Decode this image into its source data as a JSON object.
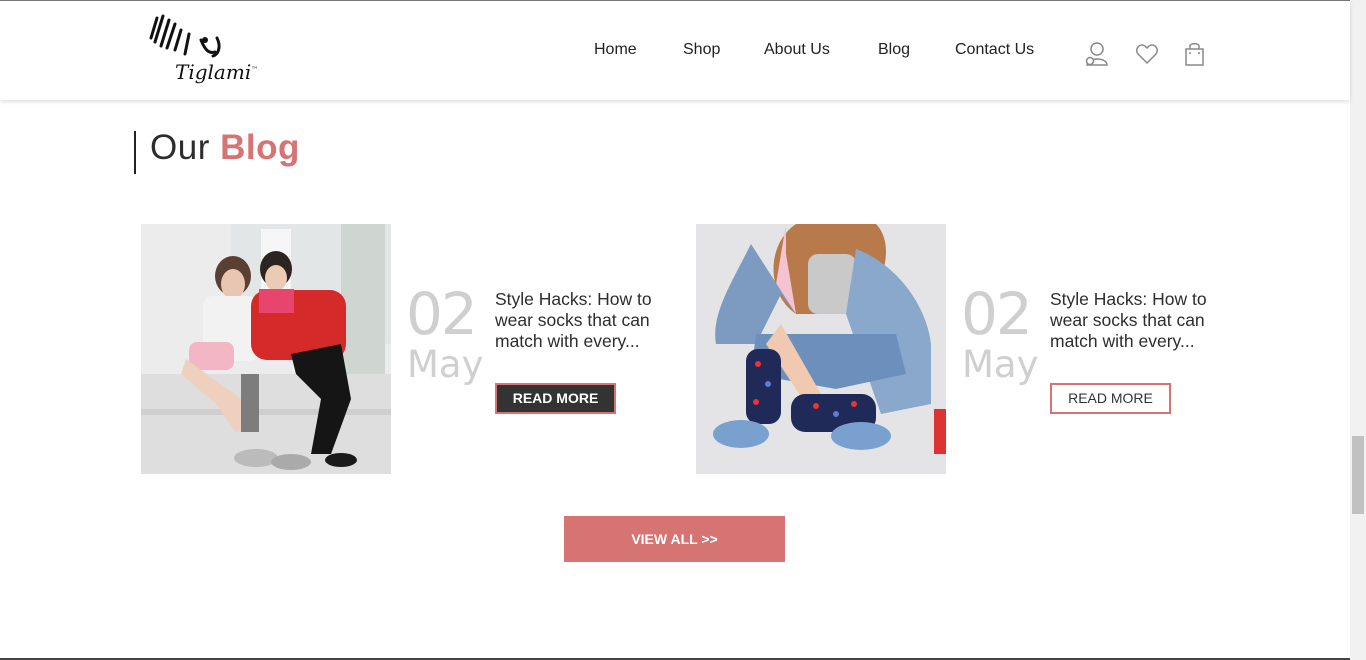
{
  "brand": {
    "logo_text": "Tiglami",
    "logo_tm": "™"
  },
  "nav": {
    "items": [
      "Home",
      "Shop",
      "About Us",
      "Blog",
      "Contact Us"
    ],
    "icons": [
      "user-icon",
      "heart-icon",
      "shopping-bag-icon"
    ]
  },
  "section": {
    "title_plain": "Our",
    "title_accent": "Blog"
  },
  "posts": [
    {
      "day": "02",
      "month": "May",
      "title": "Style Hacks: How to wear socks that can match with every...",
      "button": "READ MORE"
    },
    {
      "day": "02",
      "month": "May",
      "title": "Style Hacks: How to wear socks that can match with every...",
      "button": "READ MORE"
    }
  ],
  "view_all": "VIEW ALL >>",
  "colors": {
    "accent": "#d57472",
    "dark_button": "#333333",
    "date_gray": "#cfcfcf"
  }
}
